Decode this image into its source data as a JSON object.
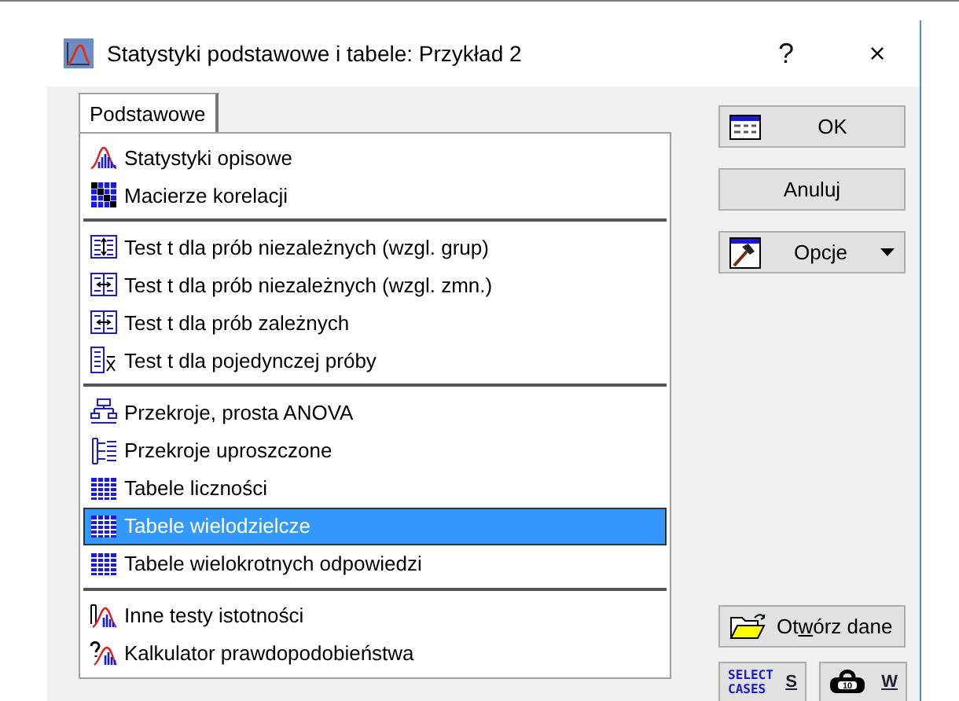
{
  "window": {
    "title": "Statystyki podstawowe i tabele: Przykład 2",
    "help": "?",
    "close": "×"
  },
  "tabs": [
    {
      "label": "Podstawowe",
      "selected": true
    }
  ],
  "sections": [
    {
      "items": [
        {
          "label": "Statystyki opisowe",
          "kind": "distribution",
          "selected": false
        },
        {
          "label": "Macierze korelacji",
          "kind": "matrix",
          "selected": false
        }
      ]
    },
    {
      "items": [
        {
          "label": "Test t dla prób niezależnych (wzgl. grup)",
          "kind": "vsplit",
          "selected": false
        },
        {
          "label": "Test t dla prób niezależnych (wzgl. zmn.)",
          "kind": "hsplit",
          "selected": false
        },
        {
          "label": "Test t dla prób zależnych",
          "kind": "hsplit",
          "selected": false
        },
        {
          "label": "Test t dla pojedynczej próby",
          "kind": "mean",
          "selected": false
        }
      ]
    },
    {
      "items": [
        {
          "label": "Przekroje, prosta ANOVA",
          "kind": "tree",
          "selected": false
        },
        {
          "label": "Przekroje uproszczone",
          "kind": "bracket",
          "selected": false
        },
        {
          "label": "Tabele liczności",
          "kind": "table",
          "selected": false
        },
        {
          "label": "Tabele wielodzielcze",
          "kind": "table",
          "selected": true
        },
        {
          "label": "Tabele wielokrotnych odpowiedzi",
          "kind": "table",
          "selected": false
        }
      ]
    },
    {
      "items": [
        {
          "label": "Inne testy istotności",
          "kind": "tests",
          "selected": false
        },
        {
          "label": "Kalkulator prawdopodobieństwa",
          "kind": "calculator",
          "selected": false
        }
      ]
    }
  ],
  "buttons": [
    {
      "label": "OK",
      "kind": "ok"
    },
    {
      "label": "Anuluj",
      "kind": "plain"
    },
    {
      "label": "Opcje",
      "kind": "options",
      "dropdown": true
    }
  ],
  "open_data": {
    "label_before_key": "Ot",
    "label_key": "w",
    "label_after_key": "órz dane"
  },
  "select_cases": {
    "icon_lines": [
      "SELECT",
      "CASES"
    ],
    "key": "S"
  },
  "weight": {
    "icon_text": "10",
    "key": "W"
  }
}
